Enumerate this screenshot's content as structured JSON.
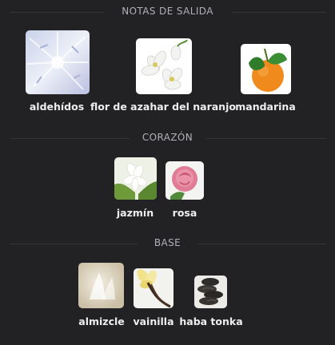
{
  "sections": {
    "top": {
      "title": "NOTAS DE SALIDA",
      "notes": [
        {
          "label": "aldehídos",
          "icon": "frost-icon"
        },
        {
          "label": "flor de azahar del naranjo",
          "icon": "orange-blossom-icon"
        },
        {
          "label": "mandarina",
          "icon": "tangerine-icon"
        }
      ]
    },
    "heart": {
      "title": "CORAZÓN",
      "notes": [
        {
          "label": "jazmín",
          "icon": "jasmine-icon"
        },
        {
          "label": "rosa",
          "icon": "rose-icon"
        }
      ]
    },
    "base": {
      "title": "BASE",
      "notes": [
        {
          "label": "almizcle",
          "icon": "musk-icon"
        },
        {
          "label": "vainilla",
          "icon": "vanilla-icon"
        },
        {
          "label": "haba tonka",
          "icon": "tonka-bean-icon"
        }
      ]
    }
  },
  "colors": {
    "background": "#222225",
    "section_title": "#b0b0b6",
    "label": "#eeeeee",
    "divider": "#333338"
  }
}
